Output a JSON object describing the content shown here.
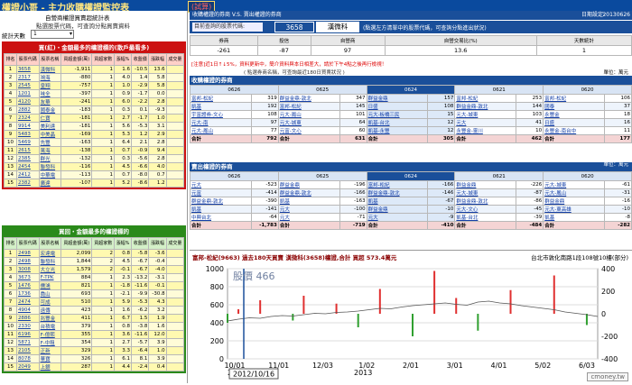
{
  "app": {
    "title": "權證小哥 - 主力收購權證監控表",
    "badge": "(試算)"
  },
  "left": {
    "subtitle": "自營商權證買賣超統計表",
    "note": "點選股票代碼，可查詢分點買賣資料",
    "days_label": "統計天數",
    "days_value": "1",
    "buy_header": "買(紅)・金額最多的權證標的(散戶最看多)",
    "sell_header": "買回・金額最多的權證標的",
    "col_headers": [
      "排名",
      "股票代碼",
      "股票名稱",
      "買超金額(萬)",
      "買超家數",
      "漲幅%",
      "收盤價",
      "漲跌幅",
      "成交量"
    ],
    "buy_rows": [
      [
        "1",
        "3658",
        "漢微科",
        "-1,911",
        "1",
        "1.6",
        "-10.5",
        "13.6"
      ],
      [
        "2",
        "2317",
        "鴻海",
        "-880",
        "1",
        "4.0",
        "1.4",
        "5.8"
      ],
      [
        "3",
        "2545",
        "皇翔",
        "-757",
        "1",
        "1.0",
        "-2.9",
        "5.8"
      ],
      [
        "4",
        "1201",
        "味全",
        "-397",
        "1",
        "0.9",
        "-1.7",
        "0.0"
      ],
      [
        "5",
        "4120",
        "友華",
        "-241",
        "1",
        "6.0",
        "-2.2",
        "2.8"
      ],
      [
        "6",
        "2882",
        "國泰金",
        "-183",
        "1",
        "0.3",
        "0.1",
        "-9.3"
      ],
      [
        "7",
        "2324",
        "仁寶",
        "-181",
        "1",
        "2.7",
        "-1.7",
        "1.0"
      ],
      [
        "8",
        "9914",
        "美利達",
        "-181",
        "1",
        "5.6",
        "-5.3",
        "3.1"
      ],
      [
        "9",
        "5483",
        "中美晶",
        "-169",
        "1",
        "5.3",
        "1.2",
        "2.9"
      ],
      [
        "10",
        "5469",
        "先豐",
        "-163",
        "1",
        "6.4",
        "2.1",
        "2.8"
      ],
      [
        "11",
        "2615",
        "萬海",
        "-138",
        "1",
        "0.7",
        "-0.9",
        "9.4"
      ],
      [
        "12",
        "2385",
        "群光",
        "-132",
        "1",
        "0.3",
        "-5.6",
        "2.8"
      ],
      [
        "13",
        "2454",
        "聯發科",
        "-116",
        "1",
        "4.5",
        "-6.6",
        "4.0"
      ],
      [
        "14",
        "2412",
        "中華電",
        "-113",
        "1",
        "0.7",
        "-8.0",
        "0.7"
      ],
      [
        "15",
        "2382",
        "廣達",
        "-107",
        "1",
        "5.2",
        "-8.6",
        "1.2"
      ]
    ],
    "sell_rows": [
      [
        "1",
        "2498",
        "宏達電",
        "2,099",
        "2",
        "0.8",
        "-5.8",
        "-3.6"
      ],
      [
        "2",
        "2498",
        "聯發科",
        "1,844",
        "2",
        "4.5",
        "-6.7",
        "-0.4"
      ],
      [
        "3",
        "3008",
        "大立光",
        "1,579",
        "2",
        "-0.1",
        "-6.7",
        "-4.0"
      ],
      [
        "4",
        "3673",
        "F-TPK",
        "884",
        "1",
        "2.3",
        "-13.2",
        "-3.1"
      ],
      [
        "5",
        "1476",
        "儒鴻",
        "821",
        "1",
        "-1.8",
        "-11.6",
        "-0.1"
      ],
      [
        "6",
        "1736",
        "喬山",
        "693",
        "1",
        "-2.1",
        "-9.9",
        "-30.8"
      ],
      [
        "7",
        "2474",
        "可成",
        "510",
        "1",
        "5.9",
        "-5.3",
        "4.3"
      ],
      [
        "8",
        "4904",
        "遠傳",
        "423",
        "1",
        "1.6",
        "-6.2",
        "3.2"
      ],
      [
        "9",
        "2886",
        "兆豐金",
        "411",
        "1",
        "6.7",
        "1.5",
        "1.9"
      ],
      [
        "10",
        "2330",
        "台積電",
        "379",
        "1",
        "0.8",
        "-3.8",
        "1.6"
      ],
      [
        "11",
        "6196",
        "F-億熙",
        "355",
        "1",
        "3.6",
        "-11.6",
        "12.0"
      ],
      [
        "12",
        "5871",
        "F-中租",
        "354",
        "1",
        "2.7",
        "-5.7",
        "3.9"
      ],
      [
        "13",
        "2105",
        "正新",
        "329",
        "1",
        "3.3",
        "-6.4",
        "1.0"
      ],
      [
        "14",
        "8078",
        "華寶",
        "326",
        "1",
        "6.1",
        "8.1",
        "3.9"
      ],
      [
        "15",
        "2049",
        "上銀",
        "287",
        "1",
        "4.4",
        "-2.4",
        "0.4"
      ]
    ]
  },
  "right": {
    "header": "收購權證的券商 V.S. 賣出權證的券商",
    "date_label": "日期設定:",
    "date_value": "20130626",
    "search_label": "目前查詢的股票代碼:",
    "search_code": "3658",
    "search_name": "漢微科",
    "search_hint": "(點選左方清單中的股票代碼，可查詢分點進出狀況)",
    "summary_headers": [
      "券商",
      "投信",
      "自營商",
      "自營交易比(%)",
      "天數統計"
    ],
    "summary_values": [
      "-261",
      "-87",
      "97",
      "13.6",
      "1"
    ],
    "warning": "[注意]近1日↑↓5%，資料更新中，簡介資料與本日相差大，請於下午4點之後再行檢視！",
    "period_note": "( 點選券商名稱，可查詢最近180日買賣狀況 )",
    "unit": "單位：萬元",
    "buy_title": "收購權證的券商",
    "sell_title": "賣出權證的券商",
    "date_cols": [
      "0626",
      "0625",
      "0624",
      "0621",
      "0620"
    ],
    "buy_table": [
      [
        [
          "富邦-松紀",
          "319"
        ],
        [
          "群益金鼎-敦北",
          "347"
        ],
        [
          "群益金鼎",
          "157"
        ],
        [
          "富邦-松紀",
          "253"
        ],
        [
          "富邦-松紀",
          "106"
        ]
      ],
      [
        [
          "凱基",
          "192"
        ],
        [
          "富邦-松紀",
          "145"
        ],
        [
          "日盛",
          "108"
        ],
        [
          "群益金鼎-敦北",
          "144"
        ],
        [
          "國泰",
          "37"
        ]
      ],
      [
        [
          "宇富證券-文心",
          "108"
        ],
        [
          "元大-鳳山",
          "101"
        ],
        [
          "元大-板橋三民",
          "15"
        ],
        [
          "元大-城東",
          "103"
        ],
        [
          "永豐金",
          "18"
        ]
      ],
      [
        [
          "元大-南",
          "97"
        ],
        [
          "元大-城東",
          "64"
        ],
        [
          "凱基-台北",
          "12"
        ],
        [
          "元大",
          "41"
        ],
        [
          "日盛",
          "16"
        ]
      ],
      [
        [
          "元大-鳳山",
          "77"
        ],
        [
          "元富-文心",
          "60"
        ],
        [
          "凱基-永豐",
          "12"
        ],
        [
          "永豐金-靈川",
          "10"
        ],
        [
          "永豐金-南台中",
          "11"
        ]
      ]
    ],
    "buy_totals": [
      "792",
      "631",
      "305",
      "462",
      "177"
    ],
    "sell_table": [
      [
        [
          "元大",
          "-523"
        ],
        [
          "群益金鼎",
          "-196"
        ],
        [
          "富邦-松紀",
          "-166"
        ],
        [
          "群益金鼎",
          "-226"
        ],
        [
          "元大-城東",
          "-61"
        ]
      ],
      [
        [
          "元富",
          "-414"
        ],
        [
          "群益金鼎-敦北",
          "-166"
        ],
        [
          "群益金鼎-敦北",
          "-146"
        ],
        [
          "元大-城東",
          "-87"
        ],
        [
          "元大-鳳山",
          "-31"
        ]
      ],
      [
        [
          "群益金鼎-敦北",
          "-390"
        ],
        [
          "凱基",
          "-163"
        ],
        [
          "凱基",
          "-67"
        ],
        [
          "群益金鼎-敦北",
          "-86"
        ],
        [
          "群益金鼎",
          "-16"
        ]
      ],
      [
        [
          "凱基",
          "-141"
        ],
        [
          "元大",
          "-100"
        ],
        [
          "群益金鼎",
          "-10"
        ],
        [
          "元大-文心",
          "-45"
        ],
        [
          "元大-東高雄",
          "-10"
        ]
      ],
      [
        [
          "中興台北",
          "-64"
        ],
        [
          "元大",
          "-71"
        ],
        [
          "元大",
          "-9"
        ],
        [
          "凱基-台北",
          "-39"
        ],
        [
          "凱基",
          "-8"
        ]
      ]
    ],
    "sell_totals": [
      "-1,783",
      "-719",
      "-410",
      "-484",
      "-282"
    ],
    "chart_title": "富邦-松紀(9663) 過去180天買賣 漢微科(3658)權證,合計 買超 573.4萬元",
    "chart_addr": "台北市敦化南路1段108號10樓(部分)",
    "watermark": "cmoney.tw"
  },
  "chart_data": {
    "type": "line",
    "title": "",
    "series": [
      {
        "name": "股價",
        "values": [
          420,
          440,
          455,
          450,
          470,
          480,
          475,
          490,
          505,
          500,
          515,
          520,
          530,
          545,
          560,
          555,
          575,
          590,
          600,
          610,
          620,
          605,
          595,
          630,
          640,
          620,
          610,
          590,
          575,
          560,
          545,
          520,
          505,
          490,
          470
        ]
      }
    ],
    "bar_series": [
      -80,
      40,
      0,
      120,
      0,
      0,
      -60,
      160,
      0,
      0,
      90,
      0,
      -120,
      0,
      220,
      0,
      0,
      -200,
      0,
      380,
      0,
      140,
      0,
      -150,
      0,
      0,
      210,
      0,
      0,
      0,
      340,
      0,
      0,
      -100,
      0
    ],
    "x_ticks": [
      "10/01",
      "11/01",
      "12/03",
      "1/02",
      "2/01",
      "3/01",
      "4/01",
      "5/02",
      "6/03"
    ],
    "x_year_labels": [
      "2012",
      "2013"
    ],
    "y_left_ticks": [
      "1000",
      "800",
      "600",
      "400",
      "200",
      "0"
    ],
    "y_right_ticks": [
      "400",
      "200",
      "0",
      "-200",
      "-400"
    ],
    "ylim_left": [
      0,
      1000
    ],
    "ylim_right": [
      -400,
      400
    ],
    "tooltip_label": "股價 466",
    "hover_date": "2012/10/16"
  }
}
